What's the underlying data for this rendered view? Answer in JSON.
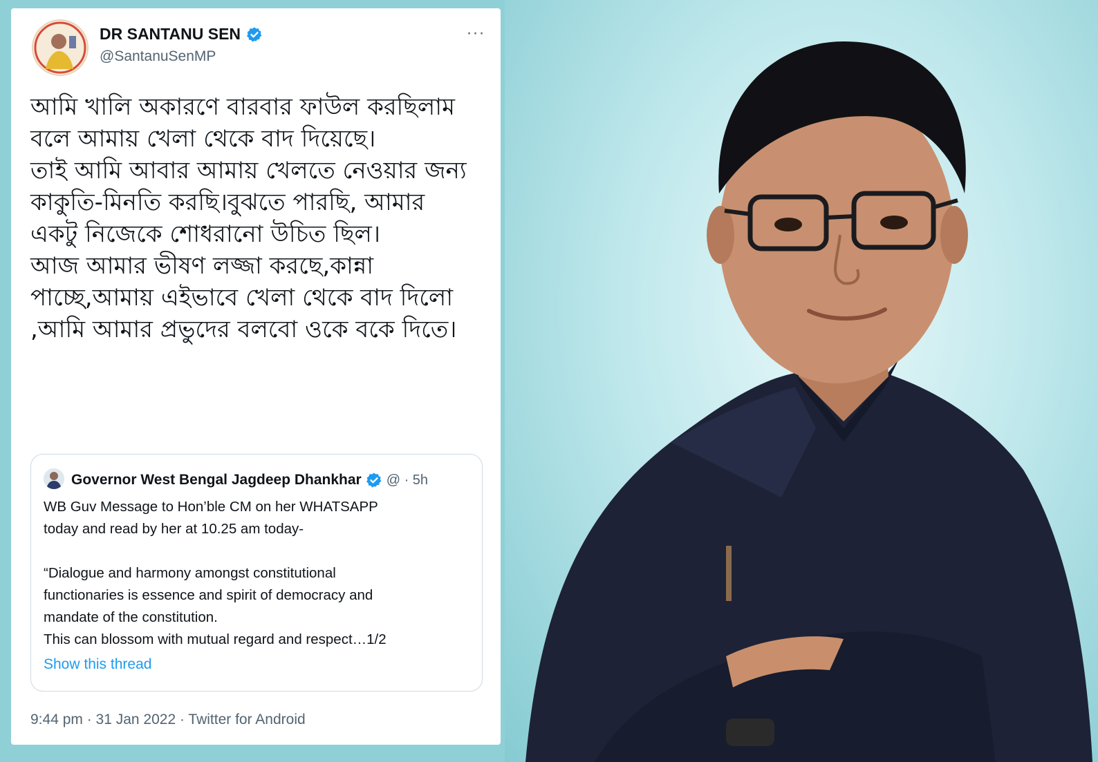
{
  "tweet": {
    "author_name": "DR SANTANU SEN",
    "author_handle": "@SantanuSenMP",
    "more_icon": "···",
    "text_paragraphs": [
      "আমি খালি অকারণে বারবার ফাউল করছিলাম বলে আমায় খেলা থেকে বাদ দিয়েছে।",
      "তাই আমি আবার আমায় খেলতে নেওয়ার জন্য কাকুতি-মিনতি করছি।বুঝতে পারছি, আমার একটু নিজেকে শোধরানো উচিত ছিল।",
      "আজ আমার ভীষণ লজ্জা করছে,কান্না পাচ্ছে,আমায় এইভাবে খেলা থেকে বাদ দিলো ,আমি আমার প্রভুদের বলবো ওকে বকে দিতে।"
    ],
    "footer": "9:44 pm · 31 Jan 2022 · Twitter for Android"
  },
  "quoted_tweet": {
    "author_name": "Governor West Bengal Jagdeep Dhankhar",
    "meta": "@ · 5h",
    "lines": [
      "WB Guv Message to Hon’ble CM on her WHATSAPP",
      "today and read by her at 10.25  am today-",
      "",
      "“Dialogue and harmony amongst constitutional",
      "functionaries is essence and spirit of democracy and",
      "mandate of the constitution.",
      "This can blossom with mutual regard and respect…1/2"
    ],
    "show_thread": "Show this thread"
  },
  "colors": {
    "verified": "#1d9bf0",
    "link": "#1d9bf0",
    "text": "#0f1419",
    "muted": "#536471",
    "background": "#8fd0d6"
  },
  "icons": {
    "verified": "verified-badge-icon",
    "more": "more-options-icon"
  }
}
